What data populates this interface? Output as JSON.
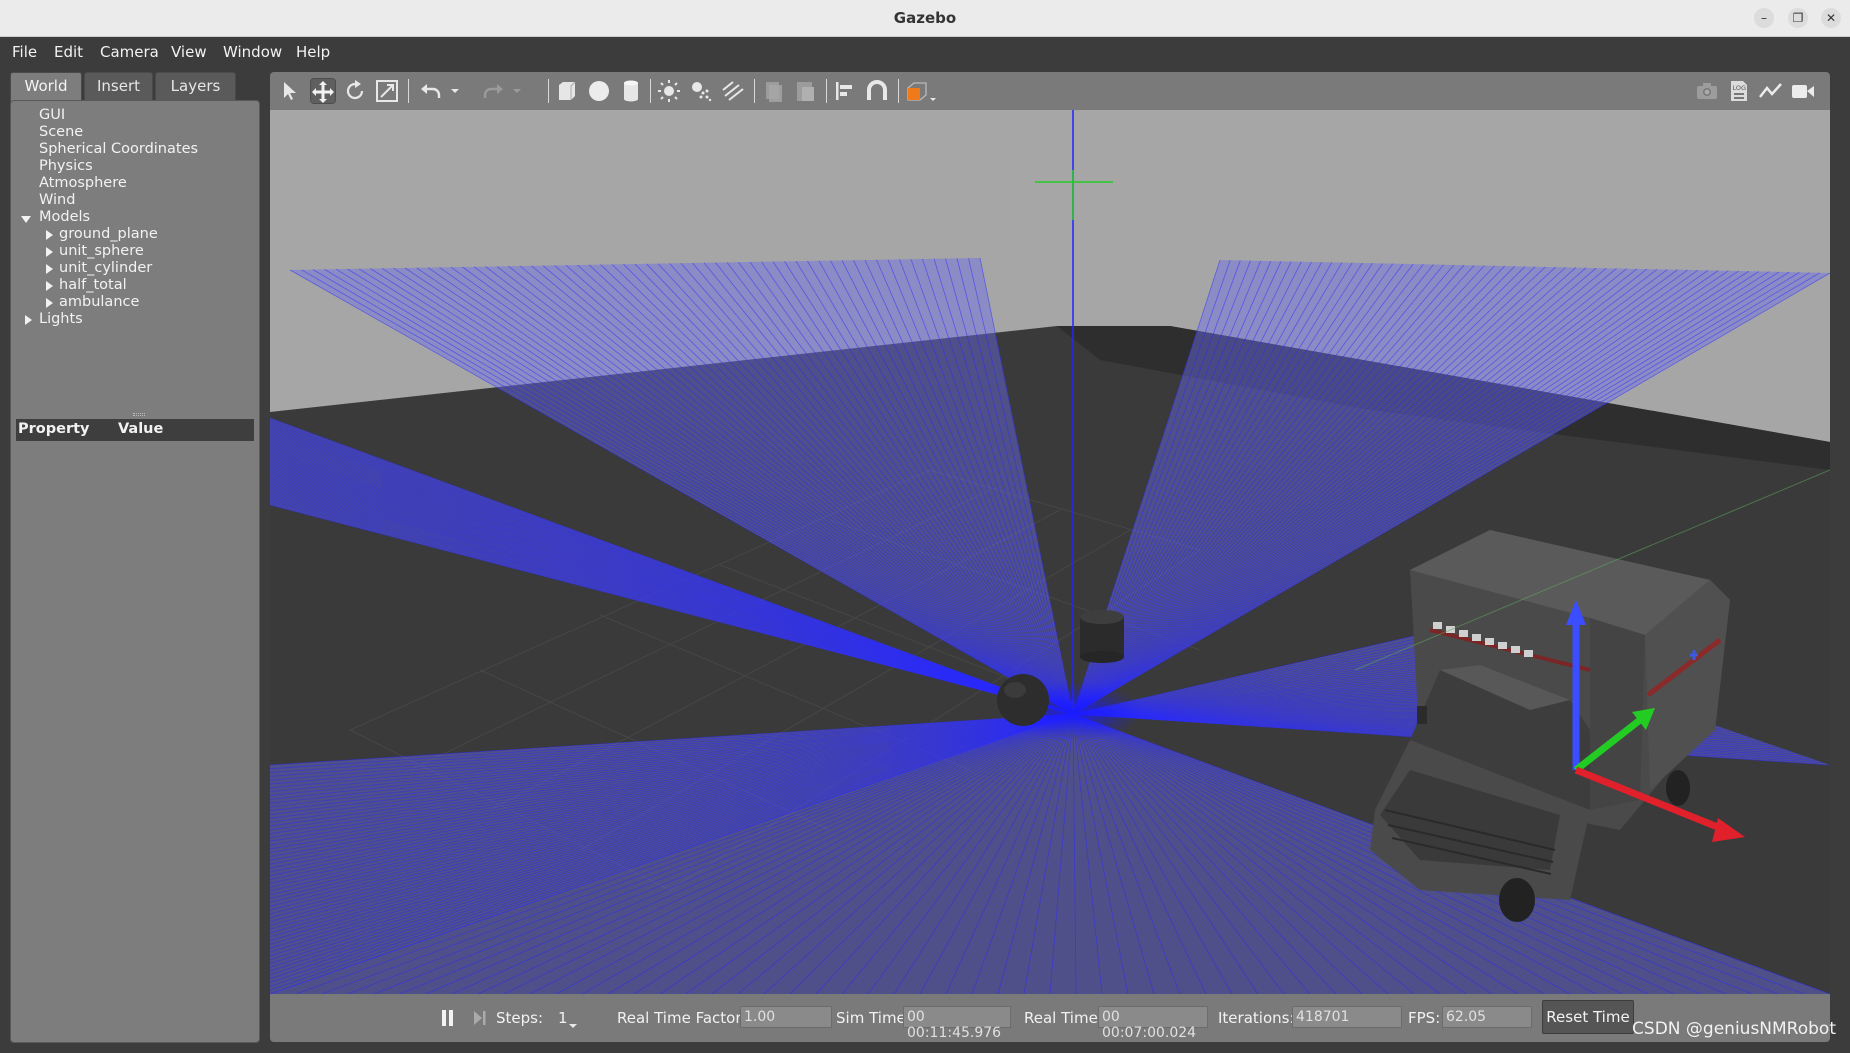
{
  "window": {
    "title": "Gazebo"
  },
  "menu": [
    {
      "label": "File",
      "key": "F"
    },
    {
      "label": "Edit",
      "key": "E"
    },
    {
      "label": "Camera",
      "key": "C"
    },
    {
      "label": "View",
      "key": "V"
    },
    {
      "label": "Window",
      "key": "W"
    },
    {
      "label": "Help",
      "key": "H"
    }
  ],
  "tabs": {
    "world": "World",
    "insert": "Insert",
    "layers": "Layers",
    "active": "World"
  },
  "tree": {
    "gui": "GUI",
    "scene": "Scene",
    "spherical": "Spherical Coordinates",
    "physics": "Physics",
    "atmosphere": "Atmosphere",
    "wind": "Wind",
    "models": "Models",
    "model_items": [
      "ground_plane",
      "unit_sphere",
      "unit_cylinder",
      "half_total",
      "ambulance"
    ],
    "lights": "Lights"
  },
  "properties": {
    "col_property": "Property",
    "col_value": "Value"
  },
  "toolbar_icons": [
    "select-arrow-icon",
    "translate-icon",
    "rotate-icon",
    "scale-icon",
    "undo-icon",
    "undo-history-icon",
    "redo-icon",
    "redo-history-icon",
    "box-shape-icon",
    "sphere-shape-icon",
    "cylinder-shape-icon",
    "point-light-icon",
    "spot-light-icon",
    "directional-light-icon",
    "copy-icon",
    "paste-icon",
    "align-icon",
    "snap-magnet-icon",
    "view-angle-icon",
    "screenshot-icon",
    "log-icon",
    "plot-icon",
    "record-video-icon"
  ],
  "bottom": {
    "steps_label": "Steps:",
    "steps_value": "1",
    "rtf_label": "Real Time Factor:",
    "rtf_value": "1.00",
    "sim_label": "Sim Time:",
    "sim_value": "00 00:11:45.976",
    "real_label": "Real Time:",
    "real_value": "00 00:07:00.024",
    "iter_label": "Iterations:",
    "iter_value": "418701",
    "fps_label": "FPS:",
    "fps_value": "62.05",
    "reset_label": "Reset Time"
  },
  "watermark": "CSDN @geniusNMRobot",
  "colors": {
    "laser_ray": "#2a2aff",
    "laser_fan": "#6a6aee",
    "sky": "#a6a6a6",
    "ground": "#3a3a3a",
    "axis_x": "#e0202a",
    "axis_y": "#22cc22",
    "axis_z": "#3a4dff"
  }
}
